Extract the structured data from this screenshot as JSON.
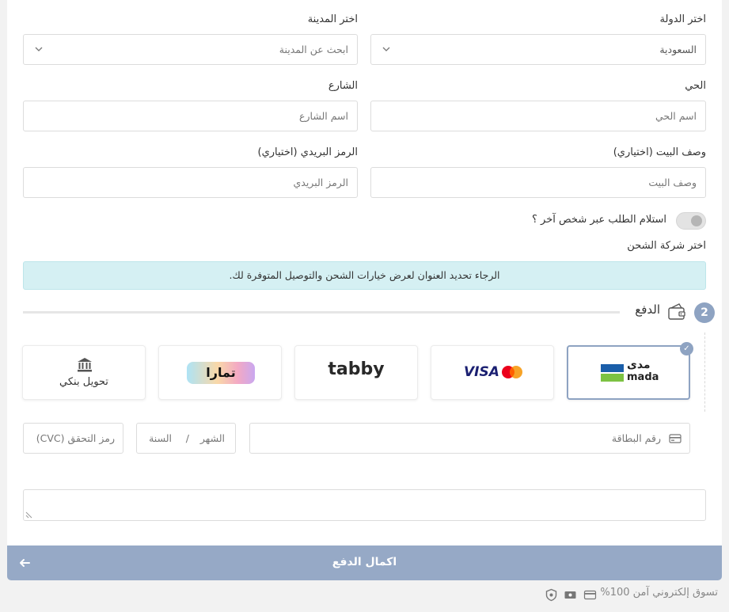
{
  "address": {
    "country": {
      "label": "اختر الدولة",
      "value": "السعودية"
    },
    "city": {
      "label": "اختر المدينة",
      "placeholder": "ابحث عن المدينة"
    },
    "district": {
      "label": "الحي",
      "placeholder": "اسم الحي"
    },
    "street": {
      "label": "الشارع",
      "placeholder": "اسم الشارع"
    },
    "house": {
      "label": "وصف البيت (اختياري)",
      "placeholder": "وصف البيت"
    },
    "postal": {
      "label": "الرمز البريدي (اختياري)",
      "placeholder": "الرمز البريدي"
    },
    "other_person": {
      "label": "استلام الطلب عبر شخص آخر ؟",
      "enabled": false
    }
  },
  "shipping": {
    "label": "اختر شركة الشحن",
    "notice": "الرجاء تحديد العنوان لعرض خيارات الشحن والتوصيل المتوفرة لك."
  },
  "payment": {
    "step_number": "2",
    "title": "الدفع",
    "methods": {
      "mada": {
        "text_ar": "مدى",
        "text_en": "mada",
        "selected": true,
        "check": "✓"
      },
      "visa": {
        "text": "VISA"
      },
      "tabby": {
        "text": "tabby"
      },
      "tamara": {
        "text": "تمارا"
      },
      "bank": {
        "text": "تحويل بنكي"
      }
    },
    "card_number": {
      "placeholder": "رقم البطاقة"
    },
    "expiry": {
      "month": "الشهر",
      "separator": "/",
      "year": "السنة"
    },
    "cvc": {
      "placeholder": "(CVC) رمز التحقق"
    }
  },
  "submit": {
    "label": "اكمال الدفع"
  },
  "footer": {
    "secure_text": "تسوق إلكتروني آمن 100%"
  },
  "colors": {
    "accent": "#8ea3c2",
    "button": "#96a9c6",
    "notice_bg": "#d5f0f3",
    "mada_blue": "#1a5ea9",
    "mada_green": "#7cc242",
    "tabby": "#292929"
  }
}
